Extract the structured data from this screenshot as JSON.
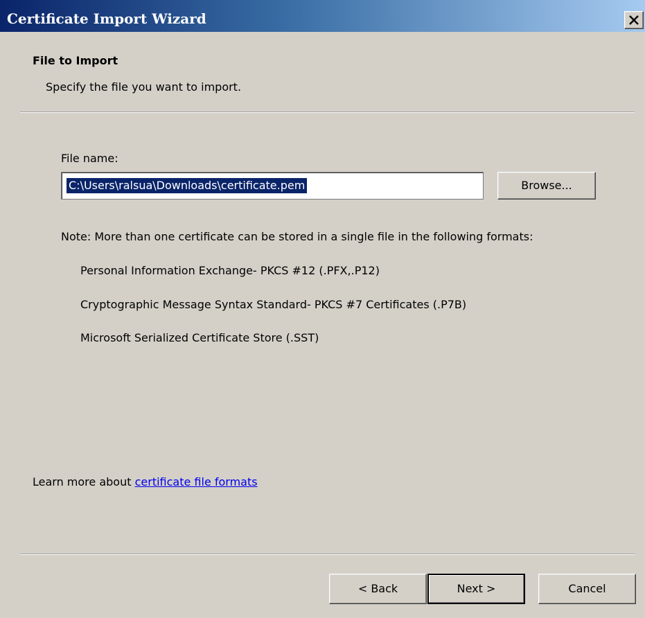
{
  "window": {
    "title": "Certificate Import Wizard",
    "close_icon": "close-icon"
  },
  "page": {
    "heading": "File to Import",
    "subheading": "Specify the file you want to import."
  },
  "file": {
    "label": "File name:",
    "value": "C:\\Users\\ralsua\\Downloads\\certificate.pem",
    "browse_label": "Browse..."
  },
  "note": {
    "text": "Note:  More than one certificate can be stored in a single file in the following formats:",
    "formats": [
      "Personal Information Exchange- PKCS #12 (.PFX,.P12)",
      "Cryptographic Message Syntax Standard- PKCS #7 Certificates (.P7B)",
      "Microsoft Serialized Certificate Store (.SST)"
    ]
  },
  "learn_more": {
    "prefix": "Learn more about ",
    "link_text": "certificate file formats"
  },
  "buttons": {
    "back": "< Back",
    "next": "Next >",
    "cancel": "Cancel"
  },
  "colors": {
    "title_gradient_start": "#0a246a",
    "title_gradient_end": "#a6caf0",
    "selection_bg": "#0a246a",
    "link": "#0000ee",
    "dialog_bg": "#d4d0c8"
  }
}
